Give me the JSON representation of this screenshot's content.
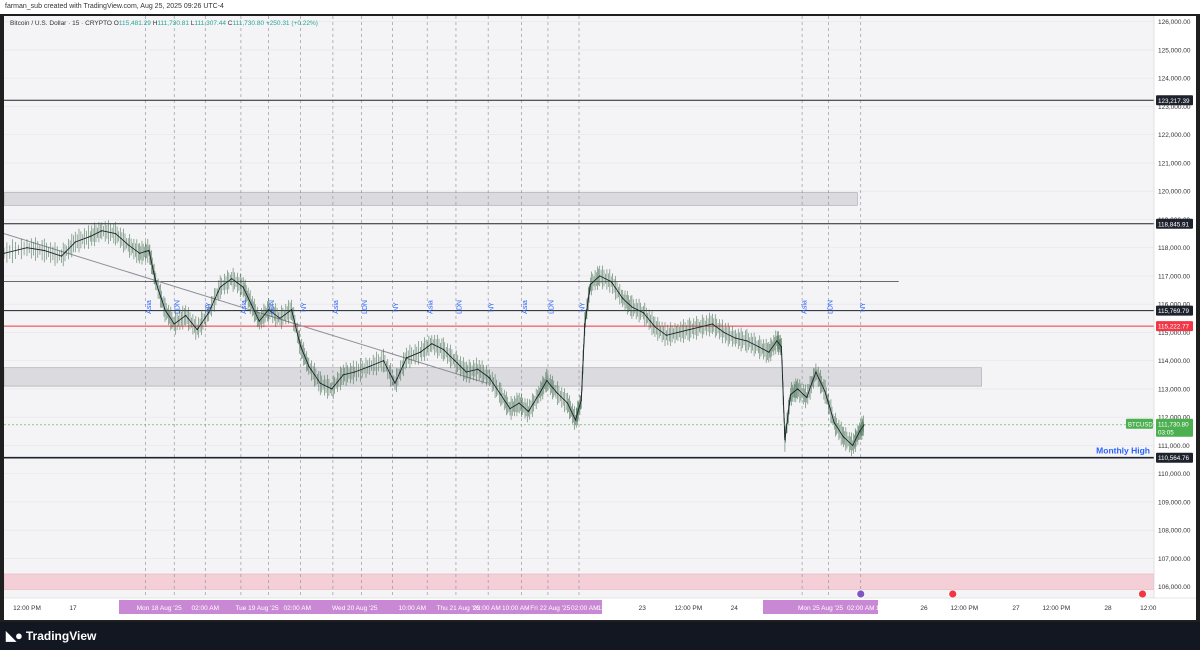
{
  "header": {
    "caption": "farman_sub created with TradingView.com, Aug 25, 2025 09:26 UTC-4"
  },
  "legend": {
    "symbol": "Bitcoin / U.S. Dollar · 15 · CRYPTO",
    "open_label": "O",
    "open": "115,481.29",
    "high_label": "H",
    "high": "111,730.81",
    "low_label": "L",
    "low": "111,307.44",
    "close_label": "C",
    "close": "111,730.80",
    "change": "+250.31 (+0.22%)"
  },
  "footer": {
    "brand": "TradingView"
  },
  "colors": {
    "up": "#26a69a",
    "down": "#1e222d",
    "red_line": "#f23645",
    "session_label": "#2962ff",
    "price_tag": "#4caf50",
    "pink_zone": "#f5c9d3"
  },
  "chart_data": {
    "type": "line",
    "symbol": "BTCUSD",
    "interval": "15",
    "ylim": [
      105600,
      126200
    ],
    "y_ticks": [
      "126,000.00",
      "125,000.00",
      "124,000.00",
      "123,000.00",
      "122,000.00",
      "121,000.00",
      "120,000.00",
      "119,000.00",
      "118,000.00",
      "117,000.00",
      "116,000.00",
      "115,000.00",
      "114,000.00",
      "113,000.00",
      "112,000.00",
      "111,000.00",
      "110,000.00",
      "109,000.00",
      "108,000.00",
      "107,000.00",
      "106,000.00"
    ],
    "y_tick_values": [
      126000,
      125000,
      124000,
      123000,
      122000,
      121000,
      120000,
      119000,
      118000,
      117000,
      116000,
      115000,
      114000,
      113000,
      112000,
      111000,
      110000,
      109000,
      108000,
      107000,
      106000
    ],
    "x_ticks": [
      {
        "label": "12:00 PM",
        "t": 0.02
      },
      {
        "label": "17",
        "t": 0.06
      },
      {
        "label": "Mon 18 Aug '25",
        "t": 0.135,
        "highlight": true
      },
      {
        "label": "02:00 AM",
        "t": 0.175,
        "highlight": true
      },
      {
        "label": "Tue 19 Aug '25",
        "t": 0.22,
        "highlight": true
      },
      {
        "label": "02:00 AM",
        "t": 0.255,
        "highlight": true
      },
      {
        "label": "Wed 20 Aug '25",
        "t": 0.305,
        "highlight": true
      },
      {
        "label": "10:00 AM",
        "t": 0.355,
        "highlight": true
      },
      {
        "label": "Thu 21 Aug '25",
        "t": 0.395,
        "highlight": true
      },
      {
        "label": "02:00 AM",
        "t": 0.42,
        "highlight": true
      },
      {
        "label": "10:00 AM",
        "t": 0.445,
        "highlight": true
      },
      {
        "label": "Fri 22 Aug '25",
        "t": 0.475,
        "highlight": true
      },
      {
        "label": "02:00 AM",
        "t": 0.505,
        "highlight": true
      },
      {
        "label": "12:00 AM",
        "t": 0.528,
        "highlight": true
      },
      {
        "label": "23",
        "t": 0.555
      },
      {
        "label": "12:00 PM",
        "t": 0.595
      },
      {
        "label": "24",
        "t": 0.635
      },
      {
        "label": "Mon 25 Aug '25",
        "t": 0.71,
        "highlight": true
      },
      {
        "label": "02:00 AM",
        "t": 0.745,
        "highlight": true
      },
      {
        "label": "10:00 AM",
        "t": 0.77,
        "highlight": true
      },
      {
        "label": "26",
        "t": 0.8
      },
      {
        "label": "12:00 PM",
        "t": 0.835
      },
      {
        "label": "27",
        "t": 0.88
      },
      {
        "label": "12:00 PM",
        "t": 0.915
      },
      {
        "label": "28",
        "t": 0.96
      },
      {
        "label": "12:00",
        "t": 0.995
      }
    ],
    "horizontal_levels": [
      {
        "value": 123217.39,
        "label": "123,217.39",
        "color": "#1e222d"
      },
      {
        "value": 118845.91,
        "label": "118,845.91",
        "color": "#1e222d"
      },
      {
        "value": 115769.79,
        "label": "115,769.79",
        "color": "#1e222d"
      },
      {
        "value": 115222.77,
        "label": "115,222.77",
        "color": "#f23645"
      },
      {
        "value": 110564.76,
        "label": "110,564.76",
        "color": "#1e222d"
      }
    ],
    "monthly_high_label": "Monthly High",
    "current_price": {
      "symbol": "BTCUSD",
      "price": "111,730.80",
      "countdown": "03:05",
      "value": 111730.8
    },
    "zones": [
      {
        "y1": 119500,
        "y2": 119950,
        "t1": 0.0,
        "t2": 0.742
      },
      {
        "y1": 113100,
        "y2": 113750,
        "t1": 0.0,
        "t2": 0.85
      },
      {
        "y1": 105900,
        "y2": 106450,
        "t1": 0.0,
        "t2": 1.0,
        "pink": true
      }
    ],
    "sessions": [
      {
        "label": "Asia",
        "t": 0.125
      },
      {
        "label": "LDN",
        "t": 0.15
      },
      {
        "label": "NY",
        "t": 0.177
      },
      {
        "label": "Asia",
        "t": 0.208
      },
      {
        "label": "LDN",
        "t": 0.232
      },
      {
        "label": "NY",
        "t": 0.26
      },
      {
        "label": "Asia",
        "t": 0.288
      },
      {
        "label": "LDN",
        "t": 0.313
      },
      {
        "label": "NY",
        "t": 0.34
      },
      {
        "label": "Asia",
        "t": 0.37
      },
      {
        "label": "LDN",
        "t": 0.395
      },
      {
        "label": "NY",
        "t": 0.423
      },
      {
        "label": "Asia",
        "t": 0.452
      },
      {
        "label": "LDN",
        "t": 0.475
      },
      {
        "label": "NY",
        "t": 0.502
      },
      {
        "label": "Asia",
        "t": 0.695
      },
      {
        "label": "LDN",
        "t": 0.718
      },
      {
        "label": "NY",
        "t": 0.746
      }
    ],
    "extra_verticals": [
      0.123,
      0.148,
      0.175,
      0.206,
      0.23,
      0.258,
      0.286,
      0.311,
      0.338,
      0.368,
      0.393,
      0.421,
      0.45,
      0.473,
      0.5,
      0.694,
      0.717,
      0.745
    ],
    "trendline": [
      {
        "t": 0.0,
        "y": 118500
      },
      {
        "t": 0.42,
        "y": 113200
      }
    ],
    "line_level_short": {
      "value": 116800,
      "t1": 0.0,
      "t2": 0.778
    },
    "series": [
      {
        "t": 0.0,
        "y": 117800
      },
      {
        "t": 0.02,
        "y": 118000
      },
      {
        "t": 0.035,
        "y": 117900
      },
      {
        "t": 0.05,
        "y": 117700
      },
      {
        "t": 0.062,
        "y": 118200
      },
      {
        "t": 0.075,
        "y": 118400
      },
      {
        "t": 0.085,
        "y": 118600
      },
      {
        "t": 0.097,
        "y": 118500
      },
      {
        "t": 0.108,
        "y": 118100
      },
      {
        "t": 0.118,
        "y": 117800
      },
      {
        "t": 0.126,
        "y": 117900
      },
      {
        "t": 0.132,
        "y": 116800
      },
      {
        "t": 0.14,
        "y": 115800
      },
      {
        "t": 0.148,
        "y": 115300
      },
      {
        "t": 0.158,
        "y": 115600
      },
      {
        "t": 0.168,
        "y": 115100
      },
      {
        "t": 0.178,
        "y": 115700
      },
      {
        "t": 0.188,
        "y": 116600
      },
      {
        "t": 0.198,
        "y": 116900
      },
      {
        "t": 0.208,
        "y": 116600
      },
      {
        "t": 0.215,
        "y": 116000
      },
      {
        "t": 0.222,
        "y": 115400
      },
      {
        "t": 0.23,
        "y": 115800
      },
      {
        "t": 0.24,
        "y": 115500
      },
      {
        "t": 0.25,
        "y": 115800
      },
      {
        "t": 0.258,
        "y": 114500
      },
      {
        "t": 0.265,
        "y": 113800
      },
      {
        "t": 0.275,
        "y": 113200
      },
      {
        "t": 0.285,
        "y": 113000
      },
      {
        "t": 0.295,
        "y": 113500
      },
      {
        "t": 0.305,
        "y": 113600
      },
      {
        "t": 0.318,
        "y": 113800
      },
      {
        "t": 0.33,
        "y": 114000
      },
      {
        "t": 0.34,
        "y": 113200
      },
      {
        "t": 0.35,
        "y": 114100
      },
      {
        "t": 0.362,
        "y": 114300
      },
      {
        "t": 0.372,
        "y": 114600
      },
      {
        "t": 0.382,
        "y": 114400
      },
      {
        "t": 0.392,
        "y": 114000
      },
      {
        "t": 0.402,
        "y": 113600
      },
      {
        "t": 0.412,
        "y": 113700
      },
      {
        "t": 0.422,
        "y": 113400
      },
      {
        "t": 0.432,
        "y": 112800
      },
      {
        "t": 0.44,
        "y": 112300
      },
      {
        "t": 0.448,
        "y": 112500
      },
      {
        "t": 0.456,
        "y": 112200
      },
      {
        "t": 0.465,
        "y": 112800
      },
      {
        "t": 0.472,
        "y": 113300
      },
      {
        "t": 0.48,
        "y": 112900
      },
      {
        "t": 0.49,
        "y": 112500
      },
      {
        "t": 0.497,
        "y": 111900
      },
      {
        "t": 0.502,
        "y": 112600
      },
      {
        "t": 0.505,
        "y": 115300
      },
      {
        "t": 0.51,
        "y": 116700
      },
      {
        "t": 0.518,
        "y": 117000
      },
      {
        "t": 0.528,
        "y": 116800
      },
      {
        "t": 0.538,
        "y": 116200
      },
      {
        "t": 0.546,
        "y": 115900
      },
      {
        "t": 0.556,
        "y": 115700
      },
      {
        "t": 0.566,
        "y": 115200
      },
      {
        "t": 0.576,
        "y": 114900
      },
      {
        "t": 0.586,
        "y": 115000
      },
      {
        "t": 0.596,
        "y": 115100
      },
      {
        "t": 0.606,
        "y": 115200
      },
      {
        "t": 0.616,
        "y": 115300
      },
      {
        "t": 0.626,
        "y": 115000
      },
      {
        "t": 0.636,
        "y": 114800
      },
      {
        "t": 0.646,
        "y": 114700
      },
      {
        "t": 0.656,
        "y": 114500
      },
      {
        "t": 0.665,
        "y": 114300
      },
      {
        "t": 0.672,
        "y": 114700
      },
      {
        "t": 0.676,
        "y": 114500
      },
      {
        "t": 0.679,
        "y": 111200
      },
      {
        "t": 0.684,
        "y": 112800
      },
      {
        "t": 0.69,
        "y": 113000
      },
      {
        "t": 0.698,
        "y": 112700
      },
      {
        "t": 0.706,
        "y": 113600
      },
      {
        "t": 0.714,
        "y": 112900
      },
      {
        "t": 0.722,
        "y": 111800
      },
      {
        "t": 0.73,
        "y": 111300
      },
      {
        "t": 0.738,
        "y": 111000
      },
      {
        "t": 0.744,
        "y": 111500
      },
      {
        "t": 0.748,
        "y": 111730
      }
    ]
  }
}
